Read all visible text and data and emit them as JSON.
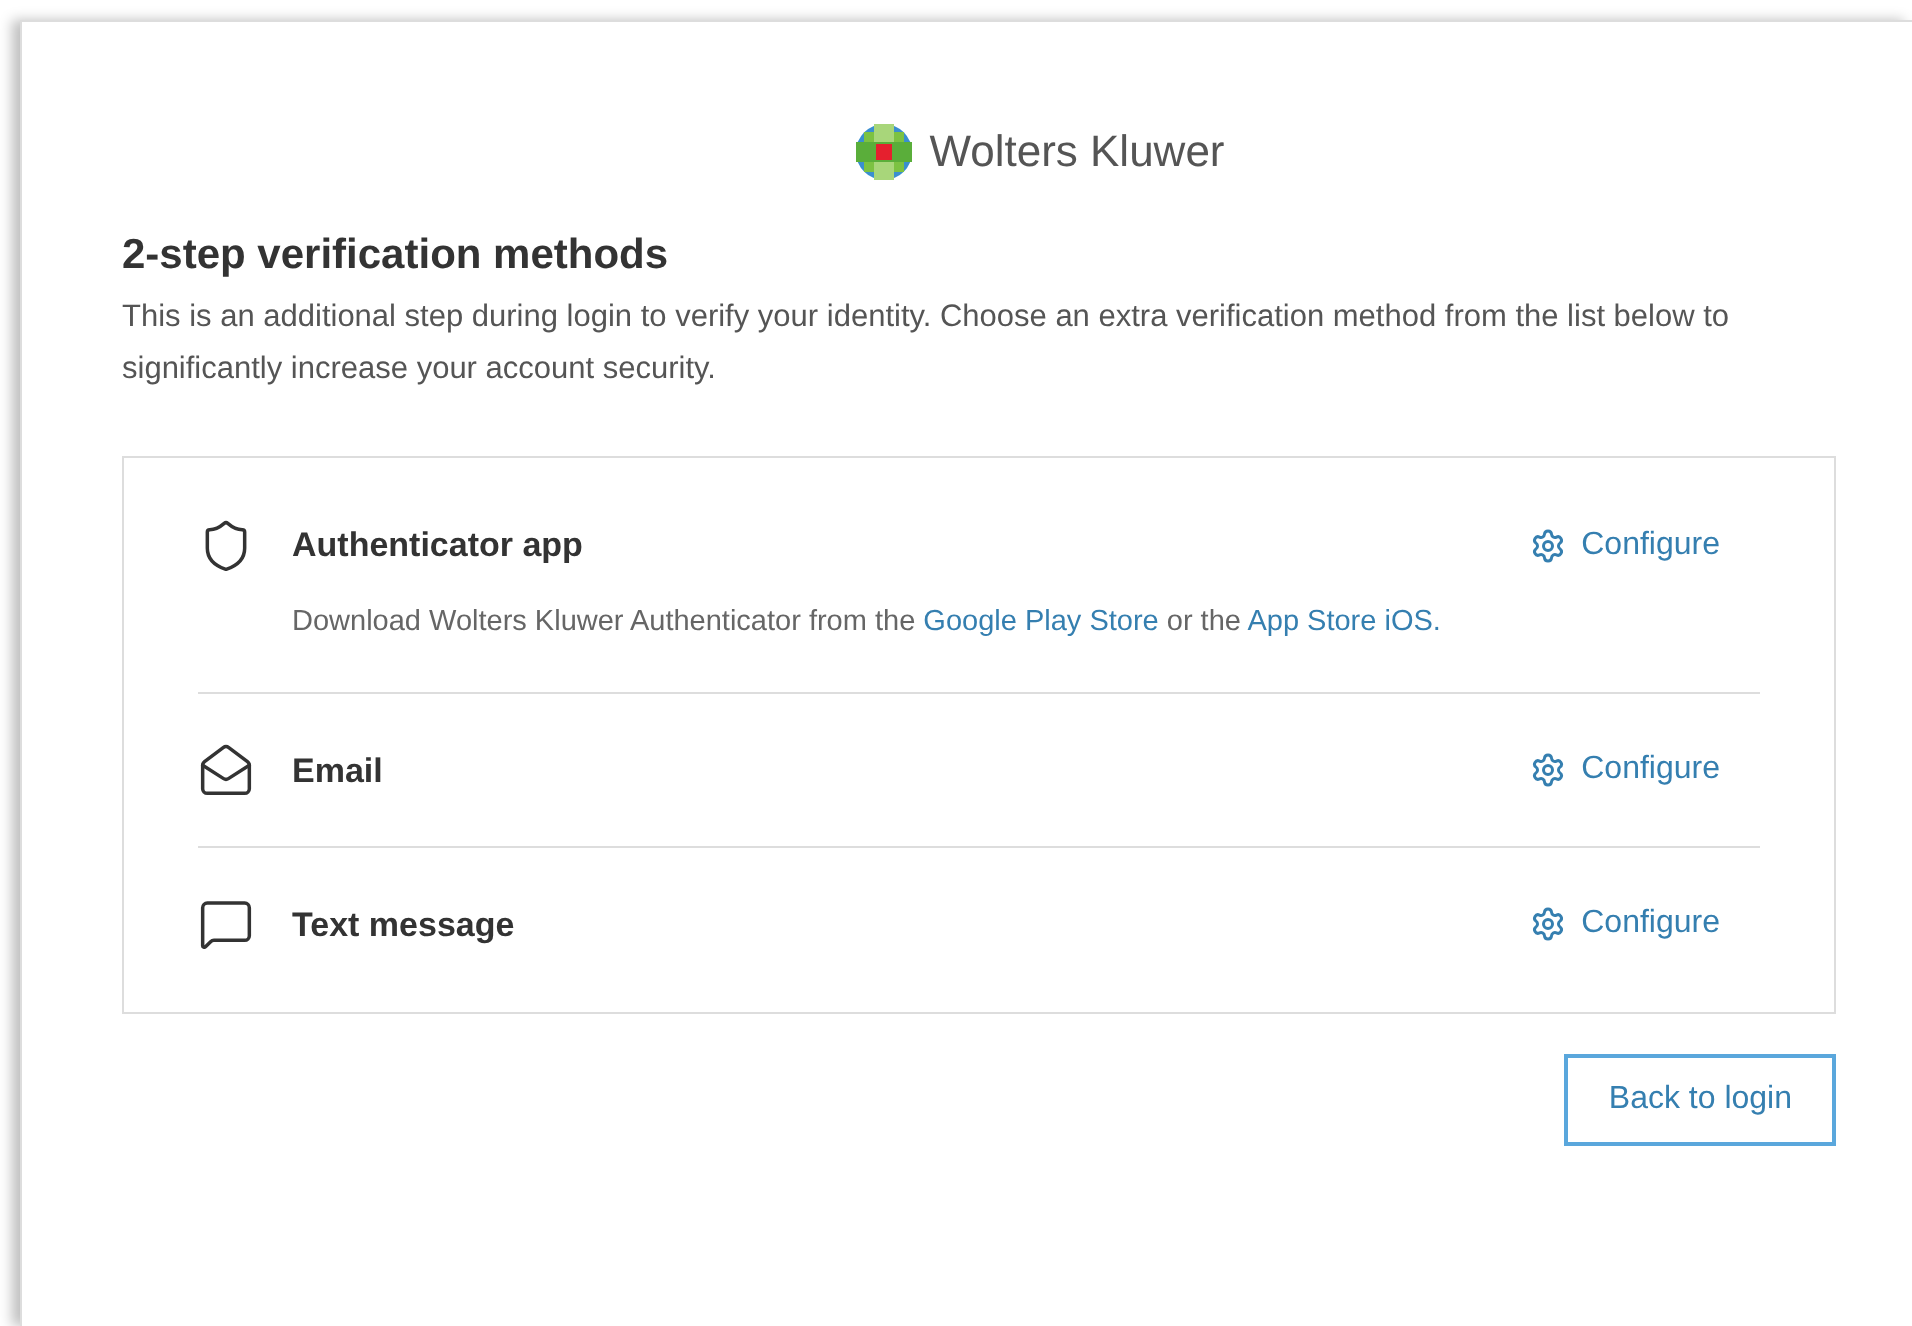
{
  "brand": {
    "name": "Wolters Kluwer"
  },
  "heading": "2-step verification methods",
  "intro": "This is an additional step during login to verify your identity. Choose an extra verification method from the list below to significantly increase your account security.",
  "methods": [
    {
      "kind": "app",
      "name": "Authenticator app",
      "action": "Configure",
      "description": [
        {
          "kind": "text",
          "text": "Download Wolters Kluwer Authenticator from the "
        },
        {
          "kind": "link",
          "text": "Google Play Store"
        },
        {
          "kind": "text",
          "text": " or the "
        },
        {
          "kind": "link",
          "text": "App Store iOS."
        }
      ]
    },
    {
      "kind": "email",
      "name": "Email",
      "action": "Configure"
    },
    {
      "kind": "sms",
      "name": "Text message",
      "action": "Configure"
    }
  ],
  "back_button": "Back to login"
}
